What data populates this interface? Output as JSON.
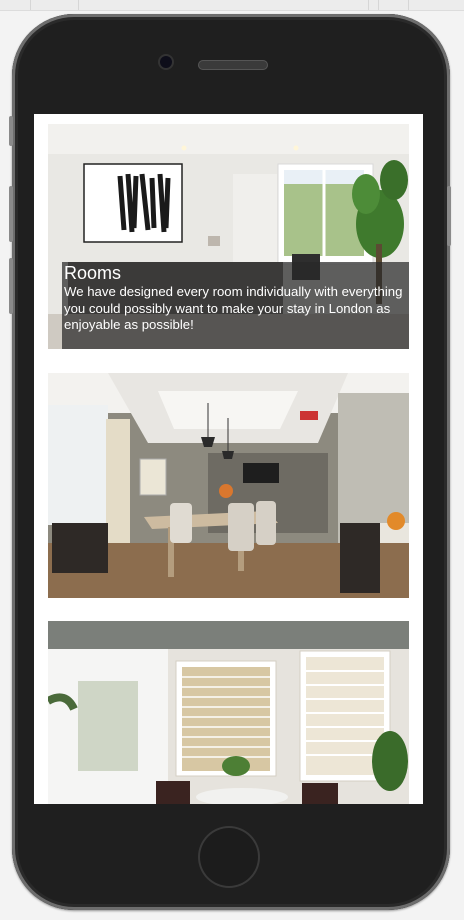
{
  "rooms_section": {
    "title": "Rooms",
    "description": "We have designed every room individually with everything you could possibly want to make your stay in London as enjoyable as possible!"
  },
  "gallery": {
    "photos": [
      {
        "subject": "living-room"
      },
      {
        "subject": "dining-room"
      },
      {
        "subject": "bedroom-window"
      }
    ]
  },
  "colors": {
    "screen_background": "#ffffff",
    "caption_overlay": "#282828",
    "phone_body": "#1f1f1f"
  }
}
